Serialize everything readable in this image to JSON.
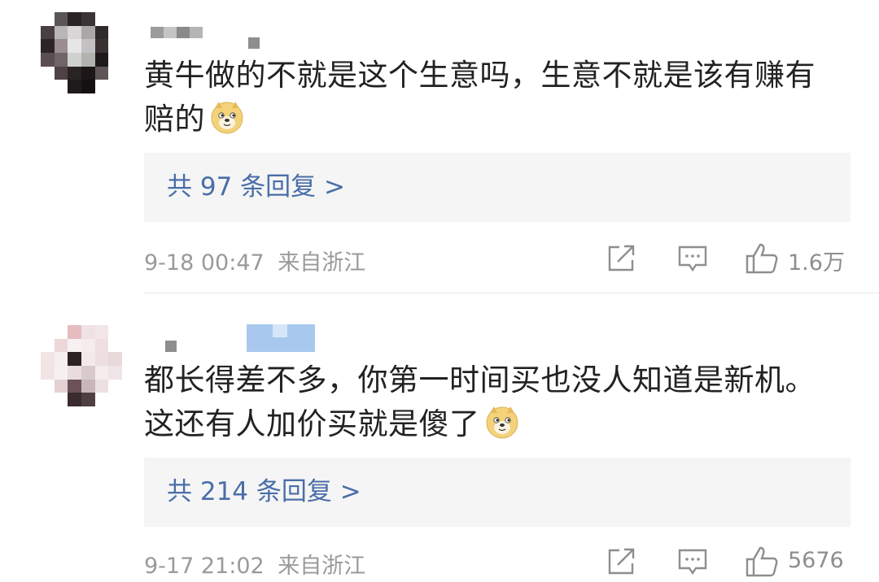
{
  "comments": [
    {
      "text_line1": "黄牛做的不就是这个生意吗，生意不就是该有赚有",
      "text_line2": "赔的",
      "emoji": "doge-emoji",
      "reply_label": "共 97 条回复 >",
      "date": "9-18 00:47",
      "location": "来自浙江",
      "likes": "1.6万"
    },
    {
      "text_line1": "都长得差不多，你第一时间买也没人知道是新机。",
      "text_line2": "这还有人加价买就是傻了",
      "emoji": "doge-emoji",
      "reply_label": "共 214 条回复 >",
      "date": "9-17 21:02",
      "location": "来自浙江",
      "likes": "5676"
    }
  ],
  "icons": {
    "share": "share-icon",
    "comment": "comment-icon",
    "like": "thumbs-up-icon"
  },
  "colors": {
    "reply_link": "#4a6ea8",
    "meta_text": "#9a9a9a",
    "reply_bg": "#f5f5f5",
    "body_text": "#222222"
  }
}
